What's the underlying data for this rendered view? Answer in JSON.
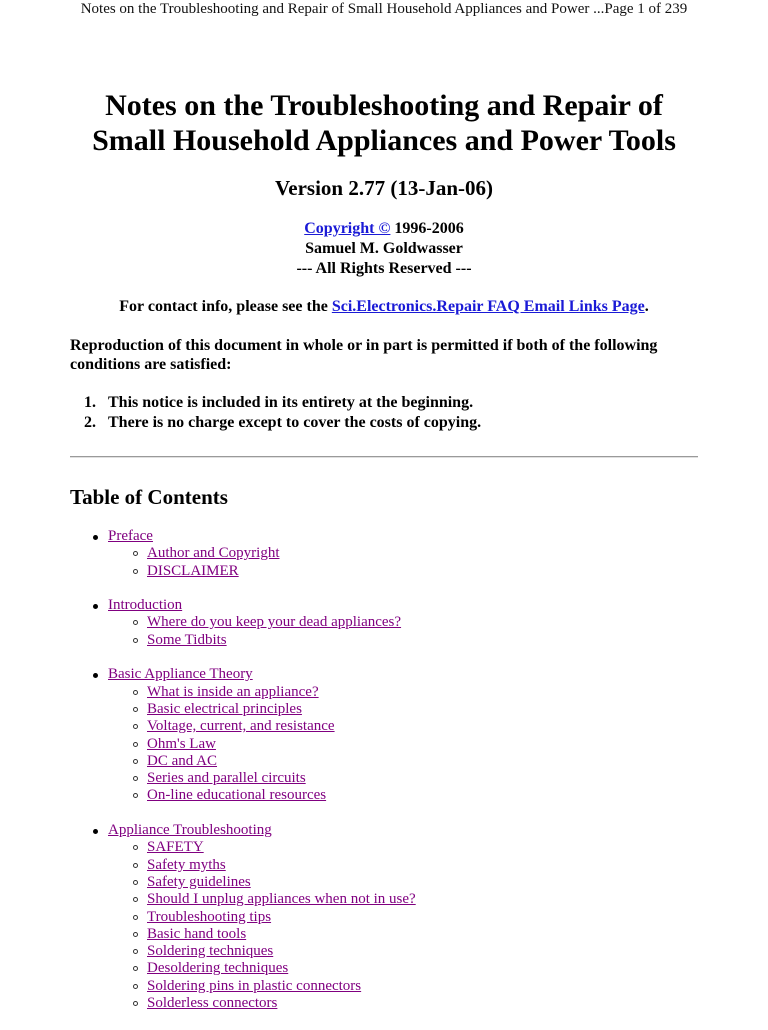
{
  "running_header": "Notes on the Troubleshooting and Repair of Small Household Appliances and Power ...Page 1 of 239",
  "title_line1": "Notes on the Troubleshooting and Repair of",
  "title_line2": "Small Household Appliances and Power Tools",
  "version": "Version 2.77 (13-Jan-06)",
  "copyright": {
    "link_label": "Copyright ©",
    "years": " 1996-2006",
    "author": "Samuel M. Goldwasser",
    "rights": "--- All Rights Reserved ---"
  },
  "contact": {
    "prefix": "For contact info, please see the ",
    "link_label": "Sci.Electronics.Repair FAQ Email Links Page",
    "suffix": "."
  },
  "reproduction_notice": "Reproduction of this document in whole or in part is permitted if both of the following conditions are satisfied:",
  "conditions": [
    {
      "num": "1.",
      "text": "This notice is included in its entirety at the beginning."
    },
    {
      "num": "2.",
      "text": "There is no charge except to cover the costs of copying."
    }
  ],
  "toc": {
    "title": "Table of Contents",
    "sections": [
      {
        "label": "Preface",
        "items": [
          "Author and Copyright",
          "DISCLAIMER"
        ]
      },
      {
        "label": "Introduction",
        "items": [
          "Where do you keep your dead appliances?",
          "Some Tidbits"
        ]
      },
      {
        "label": "Basic Appliance Theory",
        "items": [
          "What is inside an appliance?",
          "Basic electrical principles",
          "Voltage, current, and resistance",
          "Ohm's Law",
          "DC and AC",
          "Series and parallel circuits",
          "On-line educational resources"
        ]
      },
      {
        "label": "Appliance Troubleshooting",
        "items": [
          "SAFETY",
          "Safety myths",
          "Safety guidelines",
          "Should I unplug appliances when not in use?",
          "Troubleshooting tips",
          "Basic hand tools",
          "Soldering techniques",
          "Desoldering techniques",
          "Soldering pins in plastic connectors",
          "Solderless connectors"
        ]
      }
    ]
  },
  "colors": {
    "link": "#1a1ad6",
    "visited_link": "#800080",
    "rule": "#9a9a9a"
  }
}
